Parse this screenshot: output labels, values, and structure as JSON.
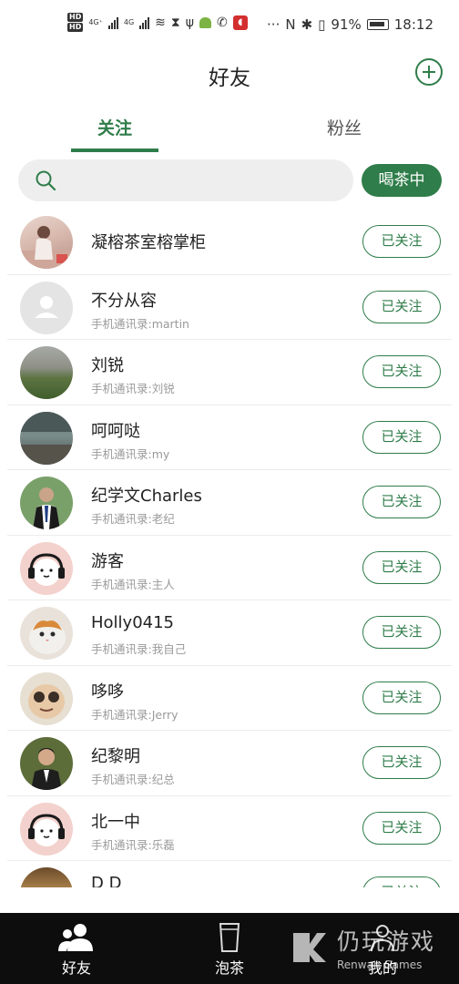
{
  "status_bar": {
    "network_labels": [
      "HD",
      "HD"
    ],
    "net_4g_1": "4G⁺",
    "net_4g_2": "4G",
    "battery": "91%",
    "time": "18:12"
  },
  "header": {
    "title": "好友",
    "add_icon": "plus-circle-icon"
  },
  "tabs": [
    {
      "label": "关注",
      "active": true
    },
    {
      "label": "粉丝",
      "active": false
    }
  ],
  "search": {
    "placeholder": "",
    "value": "",
    "button_label": "喝茶中"
  },
  "friends": [
    {
      "name": "凝榕茶室榕掌柜",
      "note": "",
      "button": "已关注"
    },
    {
      "name": "不分从容",
      "note": "手机通讯录:martin",
      "button": "已关注"
    },
    {
      "name": "刘锐",
      "note": "手机通讯录:刘锐",
      "button": "已关注"
    },
    {
      "name": "呵呵哒",
      "note": "手机通讯录:my",
      "button": "已关注"
    },
    {
      "name": "纪学文Charles",
      "note": "手机通讯录:老纪",
      "button": "已关注"
    },
    {
      "name": "游客",
      "note": "手机通讯录:主人",
      "button": "已关注"
    },
    {
      "name": "Holly0415",
      "note": "手机通讯录:我自己",
      "button": "已关注"
    },
    {
      "name": "哆哆",
      "note": "手机通讯录:Jerry",
      "button": "已关注"
    },
    {
      "name": "纪黎明",
      "note": "手机通讯录:纪总",
      "button": "已关注"
    },
    {
      "name": "北一中",
      "note": "手机通讯录:乐磊",
      "button": "已关注"
    },
    {
      "name": "D D",
      "note": "",
      "button": "已关注"
    }
  ],
  "bottom_nav": [
    {
      "label": "好友",
      "icon": "friends-icon"
    },
    {
      "label": "泡茶",
      "icon": "cup-icon"
    },
    {
      "label": "我的",
      "icon": "profile-icon"
    }
  ],
  "watermark": {
    "title": "仍玩游戏",
    "subtitle": "Renwan Games"
  },
  "colors": {
    "accent": "#2f7d4a",
    "nav_bg": "#0d0d0d"
  }
}
